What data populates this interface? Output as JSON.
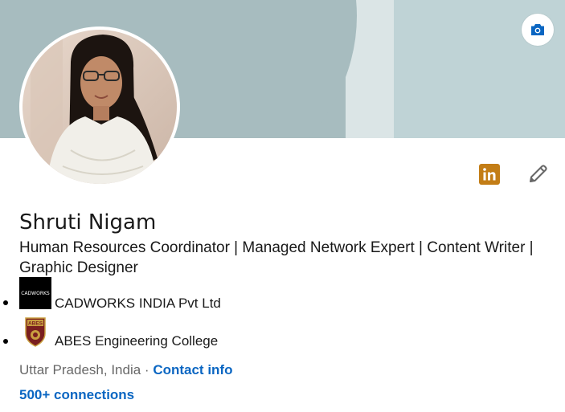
{
  "profile": {
    "name": "Shruti Nigam",
    "headline": "Human Resources Coordinator | Managed Network Expert | Content Writer | Graphic Designer",
    "location": "Uttar Pradesh, India",
    "separator": " · ",
    "contact_info_label": "Contact info",
    "connections_label": "500+ connections"
  },
  "organizations": [
    {
      "name": "CADWORKS INDIA Pvt Ltd",
      "logo_text": "CADWORKS",
      "logo_icon": "cadworks-logo"
    },
    {
      "name": "ABES Engineering College",
      "logo_text": "ABES",
      "logo_icon": "abes-crest-logo"
    }
  ],
  "icons": {
    "camera": "camera-icon",
    "linkedin": "linkedin-icon",
    "edit": "pencil-icon"
  },
  "colors": {
    "link": "#0a66c2",
    "linkedin_badge": "#c37d16",
    "cover_main": "#a7bcbf",
    "cover_light": "#dbe5e6",
    "cover_right": "#bfd3d6"
  }
}
